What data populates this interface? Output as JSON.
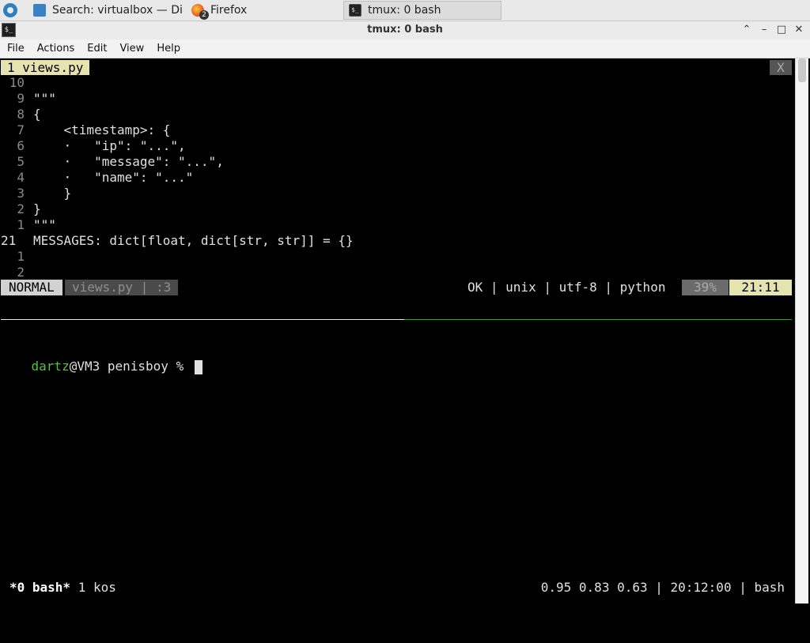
{
  "taskbar": {
    "tasks": [
      {
        "label": "Search: virtualbox — Di...",
        "icon": "folder-search-icon"
      },
      {
        "label": "Firefox",
        "icon": "firefox-icon",
        "badge": "2"
      },
      {
        "label": "tmux: 0 bash",
        "icon": "terminal-icon"
      }
    ]
  },
  "window": {
    "title": "tmux: 0 bash",
    "icon_glyph": "$_",
    "buttons": {
      "minimize": "⌃",
      "restore": "–",
      "maximize": "□",
      "close": "✕"
    }
  },
  "menu": {
    "items": [
      "File",
      "Actions",
      "Edit",
      "View",
      "Help"
    ]
  },
  "editor": {
    "buffer_tab": "1 views.py",
    "close_label": "X",
    "lines": [
      {
        "num": "10",
        "text": ""
      },
      {
        "num": "9",
        "text": "\"\"\""
      },
      {
        "num": "8",
        "text": "{"
      },
      {
        "num": "7",
        "text": "    <timestamp>: {"
      },
      {
        "num": "6",
        "text": "    ·   \"ip\": \"...\","
      },
      {
        "num": "5",
        "text": "    ·   \"message\": \"...\","
      },
      {
        "num": "4",
        "text": "    ·   \"name\": \"...\""
      },
      {
        "num": "3",
        "text": "    }"
      },
      {
        "num": "2",
        "text": "}"
      },
      {
        "num": "1",
        "text": "\"\"\""
      },
      {
        "num": "21",
        "text": "MESSAGES: dict[float, dict[str, str]] = {}"
      },
      {
        "num": "1",
        "text": ""
      },
      {
        "num": "2",
        "text": ""
      }
    ],
    "status": {
      "mode": "NORMAL",
      "file": "views.py | :3",
      "info": "OK | unix | utf-8 | python",
      "percent": "39%",
      "position": "21:11"
    }
  },
  "shell": {
    "user": "dartz",
    "host_dir": "@VM3 penisboy % "
  },
  "tmux": {
    "window": "*0 bash*",
    "window_extra": " 1 kos",
    "right": "0.95 0.83 0.63 | 20:12:00 | bash"
  }
}
